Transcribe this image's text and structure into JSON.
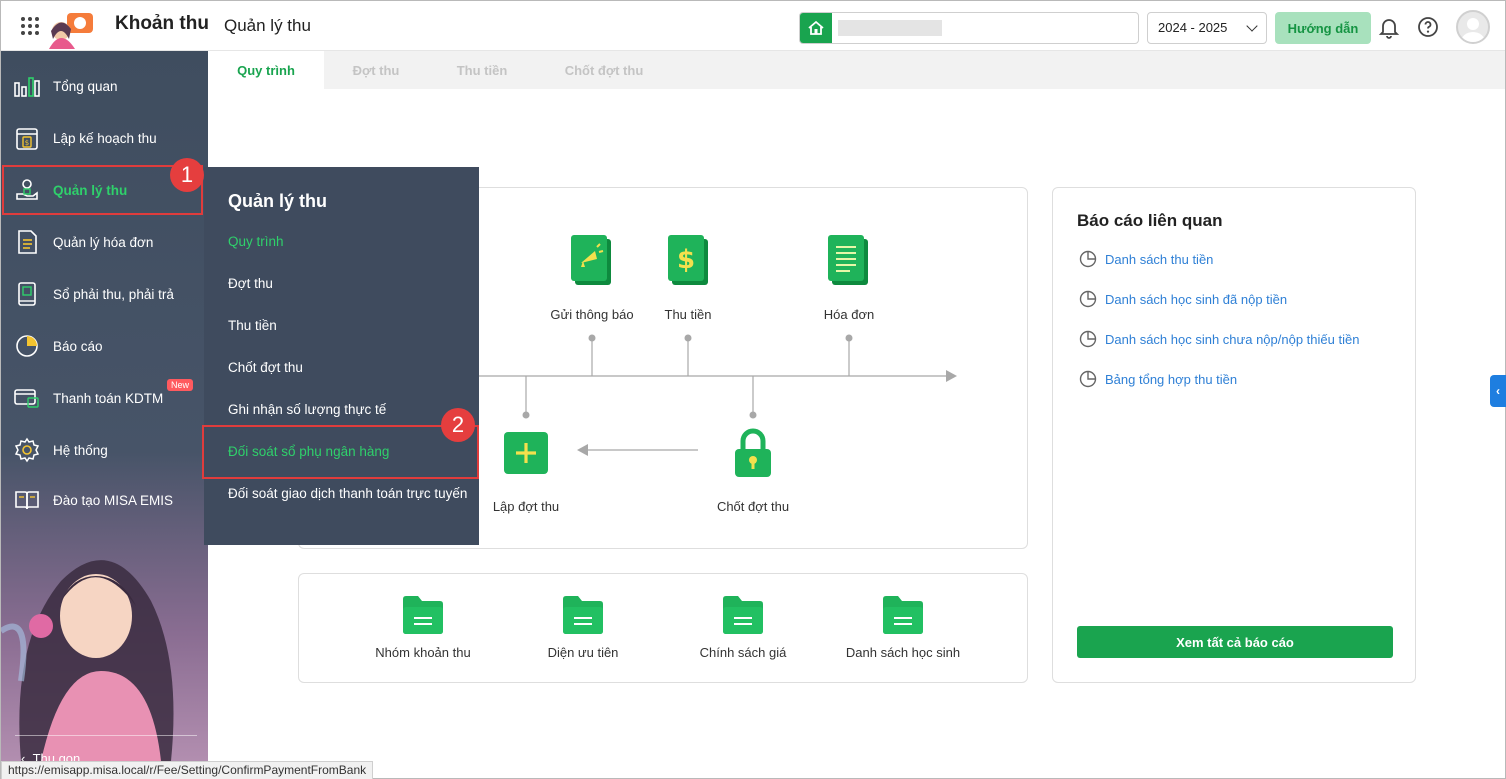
{
  "header": {
    "app_title": "Khoản thu",
    "page_title": "Quản lý thu",
    "year": "2024 - 2025",
    "guide_label": "Hướng dẫn"
  },
  "sidebar": {
    "items": [
      {
        "label": "Tổng quan",
        "icon": "chart-bars-icon"
      },
      {
        "label": "Lập kế hoạch thu",
        "icon": "calendar-dollar-icon"
      },
      {
        "label": "Quản lý thu",
        "icon": "hand-coin-icon",
        "active": true
      },
      {
        "label": "Quản lý hóa đơn",
        "icon": "invoice-icon"
      },
      {
        "label": "Sổ phải thu, phải trả",
        "icon": "ledger-icon"
      },
      {
        "label": "Báo cáo",
        "icon": "pie-chart-icon"
      },
      {
        "label": "Thanh toán KDTM",
        "icon": "card-payment-icon",
        "badge": "New"
      },
      {
        "label": "Hệ thống",
        "icon": "gear-icon"
      },
      {
        "label": "Đào tạo MISA EMIS",
        "icon": "book-icon"
      }
    ],
    "collapse_label": "Thu gọn"
  },
  "tabs": [
    "Quy trình",
    "Đợt thu",
    "Thu tiền",
    "Chốt đợt thu"
  ],
  "flyout": {
    "title": "Quản lý thu",
    "items": [
      "Quy trình",
      "Đợt thu",
      "Thu tiền",
      "Chốt đợt thu",
      "Ghi nhận số lượng thực tế",
      "Đối soát sổ phụ ngân hàng",
      "Đối soát giao dịch thanh toán trực tuyến"
    ]
  },
  "process": {
    "title_fragment": "u",
    "top_labels": [
      "Gửi thông báo",
      "Thu tiền",
      "Hóa đơn"
    ],
    "bottom_labels": [
      "Lập đợt thu",
      "Chốt đợt thu"
    ]
  },
  "folders": [
    "Nhóm khoản thu",
    "Diện ưu tiên",
    "Chính sách giá",
    "Danh sách học sinh"
  ],
  "reports": {
    "title": "Báo cáo liên quan",
    "links": [
      "Danh sách thu tiền",
      "Danh sách học sinh đã nộp tiền",
      "Danh sách học sinh chưa nộp/nộp thiếu tiền",
      "Bảng tổng hợp thu tiền"
    ],
    "view_all": "Xem tất cả báo cáo"
  },
  "steps": [
    "1",
    "2"
  ],
  "status_url": "https://emisapp.misa.local/r/Fee/Setting/ConfirmPaymentFromBank",
  "colors": {
    "accent": "#19a44f",
    "sidebar": "#3f4d5f",
    "highlight": "#e03c3c",
    "link": "#2f80d6"
  }
}
